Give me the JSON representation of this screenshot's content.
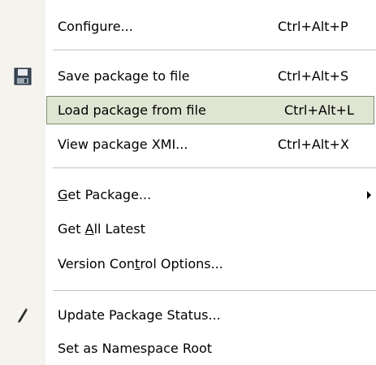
{
  "menu": {
    "items": [
      {
        "label": "Configure...",
        "shortcut": "Ctrl+Alt+P"
      },
      {
        "label": "Save package to file",
        "shortcut": "Ctrl+Alt+S",
        "icon": "floppy-disk-icon"
      },
      {
        "label": "Load package from file",
        "shortcut": "Ctrl+Alt+L",
        "highlighted": true
      },
      {
        "label": "View package XMI...",
        "shortcut": "Ctrl+Alt+X"
      },
      {
        "label_pre": "",
        "label_mnemonic": "G",
        "label_post": "et Package...",
        "has_submenu": true
      },
      {
        "label_pre": "Get ",
        "label_mnemonic": "A",
        "label_post": "ll Latest"
      },
      {
        "label_pre": "Version Con",
        "label_mnemonic": "t",
        "label_post": "rol Options..."
      },
      {
        "label": "Update Package Status...",
        "icon": "pen-icon"
      },
      {
        "label": "Set as Namespace Root"
      }
    ]
  },
  "colors": {
    "gutter": "#f4f3ee",
    "highlight_fill": "#dfe5d2",
    "highlight_border": "#7f8c6e",
    "separator": "#c5c2b8"
  }
}
